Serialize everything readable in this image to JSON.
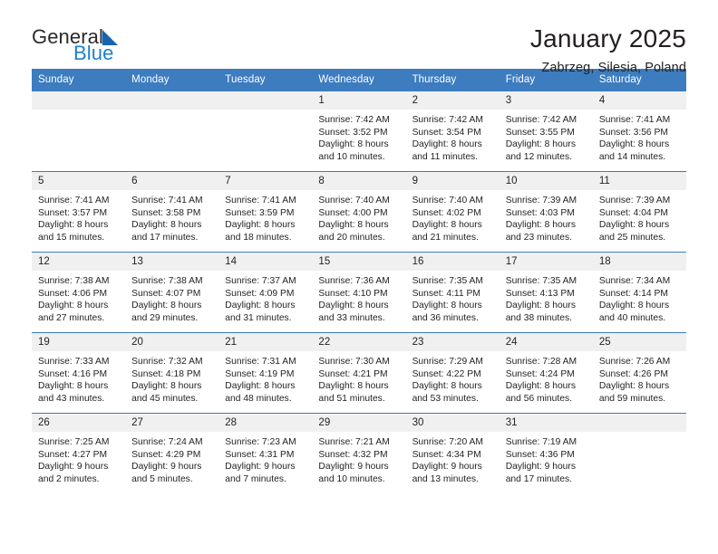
{
  "brand": {
    "name_part1": "General",
    "name_part2": "Blue",
    "triangle_color": "#1565b0",
    "blue_color": "#1f7fd0"
  },
  "header": {
    "title": "January 2025",
    "subtitle": "Zabrzeg, Silesia, Poland"
  },
  "theme": {
    "header_bg": "#3c7cbf",
    "daynum_bg": "#f0f0f0",
    "text": "#231f20"
  },
  "weekday_headers": [
    "Sunday",
    "Monday",
    "Tuesday",
    "Wednesday",
    "Thursday",
    "Friday",
    "Saturday"
  ],
  "weeks": [
    [
      {
        "day": "",
        "empty": true,
        "sunrise": "",
        "sunset": "",
        "daylight_line1": "",
        "daylight_line2": ""
      },
      {
        "day": "",
        "empty": true,
        "sunrise": "",
        "sunset": "",
        "daylight_line1": "",
        "daylight_line2": ""
      },
      {
        "day": "",
        "empty": true,
        "sunrise": "",
        "sunset": "",
        "daylight_line1": "",
        "daylight_line2": ""
      },
      {
        "day": "1",
        "empty": false,
        "sunrise": "Sunrise: 7:42 AM",
        "sunset": "Sunset: 3:52 PM",
        "daylight_line1": "Daylight: 8 hours",
        "daylight_line2": "and 10 minutes."
      },
      {
        "day": "2",
        "empty": false,
        "sunrise": "Sunrise: 7:42 AM",
        "sunset": "Sunset: 3:54 PM",
        "daylight_line1": "Daylight: 8 hours",
        "daylight_line2": "and 11 minutes."
      },
      {
        "day": "3",
        "empty": false,
        "sunrise": "Sunrise: 7:42 AM",
        "sunset": "Sunset: 3:55 PM",
        "daylight_line1": "Daylight: 8 hours",
        "daylight_line2": "and 12 minutes."
      },
      {
        "day": "4",
        "empty": false,
        "sunrise": "Sunrise: 7:41 AM",
        "sunset": "Sunset: 3:56 PM",
        "daylight_line1": "Daylight: 8 hours",
        "daylight_line2": "and 14 minutes."
      }
    ],
    [
      {
        "day": "5",
        "empty": false,
        "sunrise": "Sunrise: 7:41 AM",
        "sunset": "Sunset: 3:57 PM",
        "daylight_line1": "Daylight: 8 hours",
        "daylight_line2": "and 15 minutes."
      },
      {
        "day": "6",
        "empty": false,
        "sunrise": "Sunrise: 7:41 AM",
        "sunset": "Sunset: 3:58 PM",
        "daylight_line1": "Daylight: 8 hours",
        "daylight_line2": "and 17 minutes."
      },
      {
        "day": "7",
        "empty": false,
        "sunrise": "Sunrise: 7:41 AM",
        "sunset": "Sunset: 3:59 PM",
        "daylight_line1": "Daylight: 8 hours",
        "daylight_line2": "and 18 minutes."
      },
      {
        "day": "8",
        "empty": false,
        "sunrise": "Sunrise: 7:40 AM",
        "sunset": "Sunset: 4:00 PM",
        "daylight_line1": "Daylight: 8 hours",
        "daylight_line2": "and 20 minutes."
      },
      {
        "day": "9",
        "empty": false,
        "sunrise": "Sunrise: 7:40 AM",
        "sunset": "Sunset: 4:02 PM",
        "daylight_line1": "Daylight: 8 hours",
        "daylight_line2": "and 21 minutes."
      },
      {
        "day": "10",
        "empty": false,
        "sunrise": "Sunrise: 7:39 AM",
        "sunset": "Sunset: 4:03 PM",
        "daylight_line1": "Daylight: 8 hours",
        "daylight_line2": "and 23 minutes."
      },
      {
        "day": "11",
        "empty": false,
        "sunrise": "Sunrise: 7:39 AM",
        "sunset": "Sunset: 4:04 PM",
        "daylight_line1": "Daylight: 8 hours",
        "daylight_line2": "and 25 minutes."
      }
    ],
    [
      {
        "day": "12",
        "empty": false,
        "sunrise": "Sunrise: 7:38 AM",
        "sunset": "Sunset: 4:06 PM",
        "daylight_line1": "Daylight: 8 hours",
        "daylight_line2": "and 27 minutes."
      },
      {
        "day": "13",
        "empty": false,
        "sunrise": "Sunrise: 7:38 AM",
        "sunset": "Sunset: 4:07 PM",
        "daylight_line1": "Daylight: 8 hours",
        "daylight_line2": "and 29 minutes."
      },
      {
        "day": "14",
        "empty": false,
        "sunrise": "Sunrise: 7:37 AM",
        "sunset": "Sunset: 4:09 PM",
        "daylight_line1": "Daylight: 8 hours",
        "daylight_line2": "and 31 minutes."
      },
      {
        "day": "15",
        "empty": false,
        "sunrise": "Sunrise: 7:36 AM",
        "sunset": "Sunset: 4:10 PM",
        "daylight_line1": "Daylight: 8 hours",
        "daylight_line2": "and 33 minutes."
      },
      {
        "day": "16",
        "empty": false,
        "sunrise": "Sunrise: 7:35 AM",
        "sunset": "Sunset: 4:11 PM",
        "daylight_line1": "Daylight: 8 hours",
        "daylight_line2": "and 36 minutes."
      },
      {
        "day": "17",
        "empty": false,
        "sunrise": "Sunrise: 7:35 AM",
        "sunset": "Sunset: 4:13 PM",
        "daylight_line1": "Daylight: 8 hours",
        "daylight_line2": "and 38 minutes."
      },
      {
        "day": "18",
        "empty": false,
        "sunrise": "Sunrise: 7:34 AM",
        "sunset": "Sunset: 4:14 PM",
        "daylight_line1": "Daylight: 8 hours",
        "daylight_line2": "and 40 minutes."
      }
    ],
    [
      {
        "day": "19",
        "empty": false,
        "sunrise": "Sunrise: 7:33 AM",
        "sunset": "Sunset: 4:16 PM",
        "daylight_line1": "Daylight: 8 hours",
        "daylight_line2": "and 43 minutes."
      },
      {
        "day": "20",
        "empty": false,
        "sunrise": "Sunrise: 7:32 AM",
        "sunset": "Sunset: 4:18 PM",
        "daylight_line1": "Daylight: 8 hours",
        "daylight_line2": "and 45 minutes."
      },
      {
        "day": "21",
        "empty": false,
        "sunrise": "Sunrise: 7:31 AM",
        "sunset": "Sunset: 4:19 PM",
        "daylight_line1": "Daylight: 8 hours",
        "daylight_line2": "and 48 minutes."
      },
      {
        "day": "22",
        "empty": false,
        "sunrise": "Sunrise: 7:30 AM",
        "sunset": "Sunset: 4:21 PM",
        "daylight_line1": "Daylight: 8 hours",
        "daylight_line2": "and 51 minutes."
      },
      {
        "day": "23",
        "empty": false,
        "sunrise": "Sunrise: 7:29 AM",
        "sunset": "Sunset: 4:22 PM",
        "daylight_line1": "Daylight: 8 hours",
        "daylight_line2": "and 53 minutes."
      },
      {
        "day": "24",
        "empty": false,
        "sunrise": "Sunrise: 7:28 AM",
        "sunset": "Sunset: 4:24 PM",
        "daylight_line1": "Daylight: 8 hours",
        "daylight_line2": "and 56 minutes."
      },
      {
        "day": "25",
        "empty": false,
        "sunrise": "Sunrise: 7:26 AM",
        "sunset": "Sunset: 4:26 PM",
        "daylight_line1": "Daylight: 8 hours",
        "daylight_line2": "and 59 minutes."
      }
    ],
    [
      {
        "day": "26",
        "empty": false,
        "sunrise": "Sunrise: 7:25 AM",
        "sunset": "Sunset: 4:27 PM",
        "daylight_line1": "Daylight: 9 hours",
        "daylight_line2": "and 2 minutes."
      },
      {
        "day": "27",
        "empty": false,
        "sunrise": "Sunrise: 7:24 AM",
        "sunset": "Sunset: 4:29 PM",
        "daylight_line1": "Daylight: 9 hours",
        "daylight_line2": "and 5 minutes."
      },
      {
        "day": "28",
        "empty": false,
        "sunrise": "Sunrise: 7:23 AM",
        "sunset": "Sunset: 4:31 PM",
        "daylight_line1": "Daylight: 9 hours",
        "daylight_line2": "and 7 minutes."
      },
      {
        "day": "29",
        "empty": false,
        "sunrise": "Sunrise: 7:21 AM",
        "sunset": "Sunset: 4:32 PM",
        "daylight_line1": "Daylight: 9 hours",
        "daylight_line2": "and 10 minutes."
      },
      {
        "day": "30",
        "empty": false,
        "sunrise": "Sunrise: 7:20 AM",
        "sunset": "Sunset: 4:34 PM",
        "daylight_line1": "Daylight: 9 hours",
        "daylight_line2": "and 13 minutes."
      },
      {
        "day": "31",
        "empty": false,
        "sunrise": "Sunrise: 7:19 AM",
        "sunset": "Sunset: 4:36 PM",
        "daylight_line1": "Daylight: 9 hours",
        "daylight_line2": "and 17 minutes."
      },
      {
        "day": "",
        "empty": true,
        "sunrise": "",
        "sunset": "",
        "daylight_line1": "",
        "daylight_line2": ""
      }
    ]
  ]
}
